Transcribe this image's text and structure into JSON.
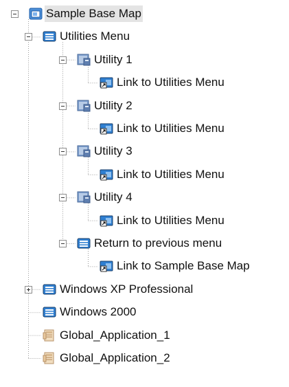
{
  "tree": {
    "items": [
      {
        "id": "sample-base-map",
        "label": "Sample Base Map",
        "icon": "base-map-icon",
        "level": 0,
        "toggle": "expanded",
        "selected": true
      },
      {
        "id": "utilities-menu",
        "label": "Utilities Menu",
        "icon": "menu-icon",
        "level": 1,
        "toggle": "expanded"
      },
      {
        "id": "utility-1",
        "label": "Utility 1",
        "icon": "utility-icon",
        "level": 2,
        "toggle": "expanded"
      },
      {
        "id": "utility-1-link",
        "label": "Link to Utilities Menu",
        "icon": "link-icon",
        "level": 3
      },
      {
        "id": "utility-2",
        "label": "Utility 2",
        "icon": "utility-icon",
        "level": 2,
        "toggle": "expanded"
      },
      {
        "id": "utility-2-link",
        "label": "Link to Utilities Menu",
        "icon": "link-icon",
        "level": 3
      },
      {
        "id": "utility-3",
        "label": "Utility 3",
        "icon": "utility-icon",
        "level": 2,
        "toggle": "expanded"
      },
      {
        "id": "utility-3-link",
        "label": "Link to Utilities Menu",
        "icon": "link-icon",
        "level": 3
      },
      {
        "id": "utility-4",
        "label": "Utility 4",
        "icon": "utility-icon",
        "level": 2,
        "toggle": "expanded"
      },
      {
        "id": "utility-4-link",
        "label": "Link to Utilities Menu",
        "icon": "link-icon",
        "level": 3
      },
      {
        "id": "return-previous",
        "label": "Return to previous menu",
        "icon": "menu-icon",
        "level": 2,
        "toggle": "expanded"
      },
      {
        "id": "return-link",
        "label": "Link to Sample Base Map",
        "icon": "link-icon",
        "level": 3
      },
      {
        "id": "windows-xp",
        "label": "Windows XP Professional",
        "icon": "menu-icon",
        "level": 1,
        "toggle": "collapsed"
      },
      {
        "id": "windows-2000",
        "label": "Windows 2000",
        "icon": "menu-icon",
        "level": 1
      },
      {
        "id": "global-app-1",
        "label": "Global_Application_1",
        "icon": "application-icon",
        "level": 1
      },
      {
        "id": "global-app-2",
        "label": "Global_Application_2",
        "icon": "application-icon",
        "level": 1
      }
    ]
  },
  "colors": {
    "guide_line": "#9a9a9a",
    "selection": "#e4e4e4",
    "blue_icon": "#2f7fd1",
    "icon_dark": "#1b3f69"
  }
}
